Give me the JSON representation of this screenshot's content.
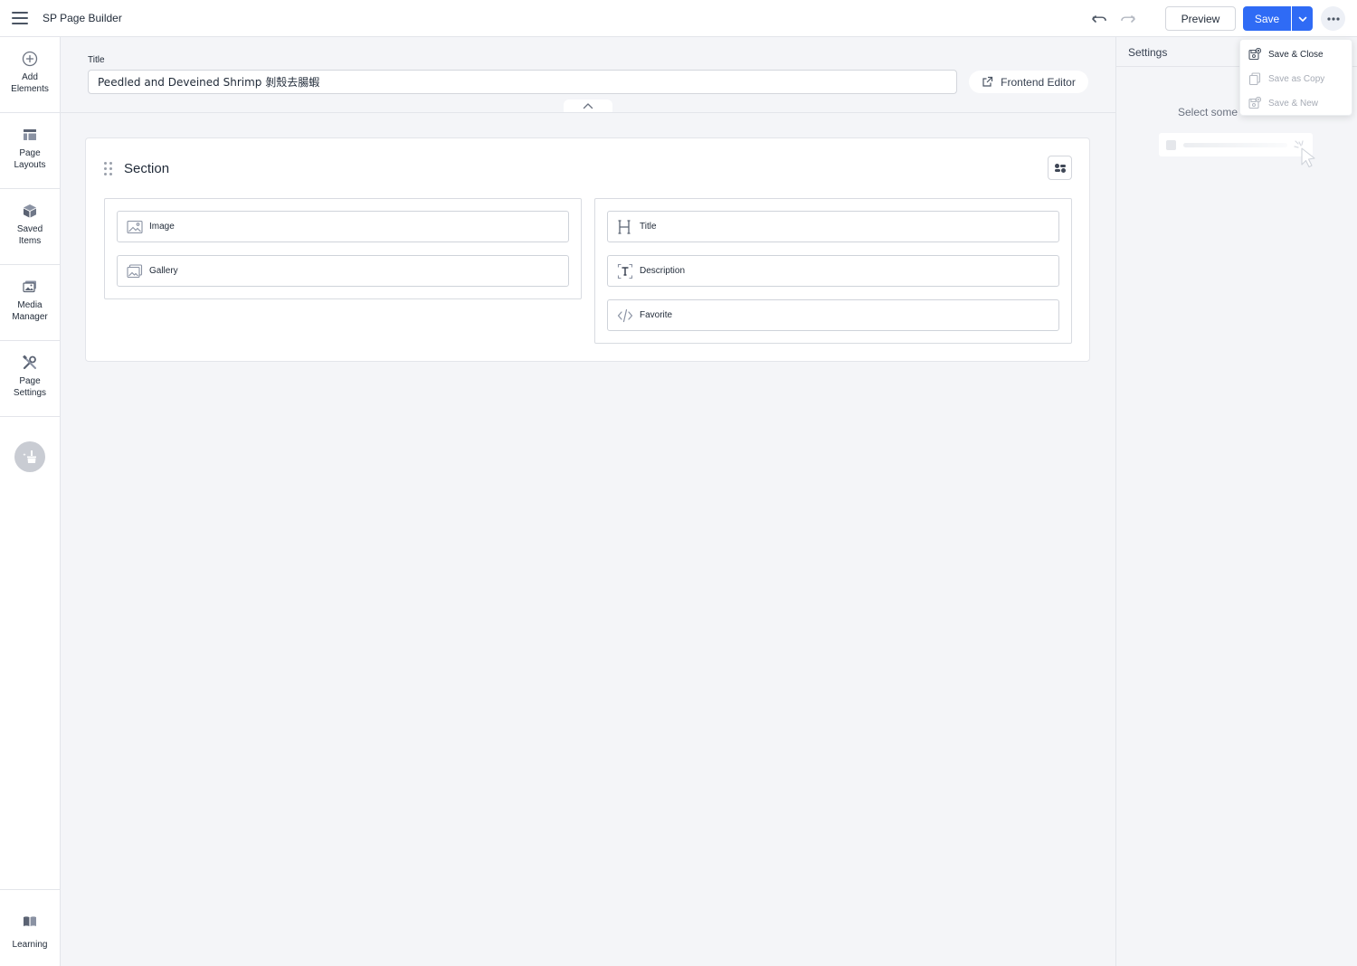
{
  "topbar": {
    "app_title": "SP Page Builder",
    "preview_label": "Preview",
    "save_label": "Save"
  },
  "save_menu": {
    "items": [
      {
        "label": "Save & Close",
        "enabled": true
      },
      {
        "label": "Save as Copy",
        "enabled": false
      },
      {
        "label": "Save & New",
        "enabled": false
      }
    ]
  },
  "sidebar": {
    "items": [
      {
        "label": "Add\nElements",
        "icon": "plus-circle-icon"
      },
      {
        "label": "Page\nLayouts",
        "icon": "layout-icon"
      },
      {
        "label": "Saved\nItems",
        "icon": "box-icon"
      },
      {
        "label": "Media\nManager",
        "icon": "media-icon"
      },
      {
        "label": "Page\nSettings",
        "icon": "tools-icon"
      }
    ],
    "learning_label": "Learning"
  },
  "title_area": {
    "label": "Title",
    "value": "Peedled and Deveined Shrimp 剝殼去腸蝦",
    "frontend_editor_label": "Frontend Editor"
  },
  "section": {
    "title": "Section",
    "columns": [
      {
        "addons": [
          {
            "label": "Image",
            "icon": "image-icon"
          },
          {
            "label": "Gallery",
            "icon": "gallery-icon"
          }
        ]
      },
      {
        "addons": [
          {
            "label": "Title",
            "icon": "heading-icon"
          },
          {
            "label": "Description",
            "icon": "text-icon"
          },
          {
            "label": "Favorite",
            "icon": "code-icon"
          }
        ]
      }
    ]
  },
  "settings_panel": {
    "title": "Settings",
    "empty_text": "Select some"
  },
  "colors": {
    "accent": "#2f6bf5",
    "canvas_bg": "#f4f5f8",
    "border": "#e3e5ea"
  }
}
